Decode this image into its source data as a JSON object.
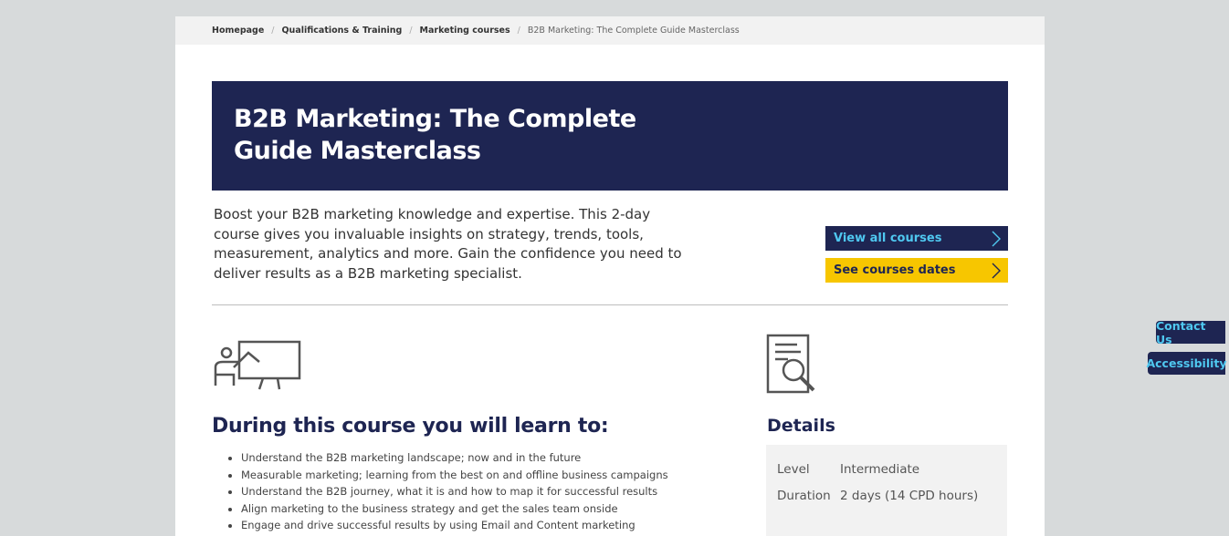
{
  "breadcrumb": {
    "items": [
      "Homepage",
      "Qualifications & Training",
      "Marketing courses"
    ],
    "current": "B2B Marketing: The Complete Guide Masterclass",
    "separator": "/"
  },
  "hero": {
    "title": "B2B Marketing: The Complete Guide Masterclass"
  },
  "intro": {
    "text": "Boost your B2B marketing knowledge and expertise. This 2-day course gives you invaluable insights on strategy, trends, tools, measurement, analytics and more. Gain the confidence you need to deliver results as a B2B marketing specialist."
  },
  "buttons": {
    "view_all": "View all courses",
    "see_dates": "See courses dates"
  },
  "learn": {
    "title": "During this course you will learn to:",
    "items": [
      "Understand the B2B marketing landscape; now and in the future",
      "Measurable marketing; learning from the best on and offline business campaigns",
      "Understand the B2B journey, what it is and how to map it for successful results",
      "Align marketing to the business strategy and get the sales team onside",
      "Engage and drive successful results by using Email and Content marketing"
    ]
  },
  "details": {
    "title": "Details",
    "rows": [
      {
        "key": "Level",
        "value": "Intermediate"
      },
      {
        "key": "Duration",
        "value": "2 days (14 CPD hours)"
      }
    ]
  },
  "side_tabs": {
    "contact": "Contact Us",
    "accessibility": "Accessibility"
  },
  "colors": {
    "navy": "#1e2552",
    "yellow": "#f7c600",
    "cyan": "#4fc8f0"
  },
  "icons": {
    "teach": "presentation-board-icon",
    "doc": "document-search-icon",
    "chevron": "chevron-right-icon"
  }
}
